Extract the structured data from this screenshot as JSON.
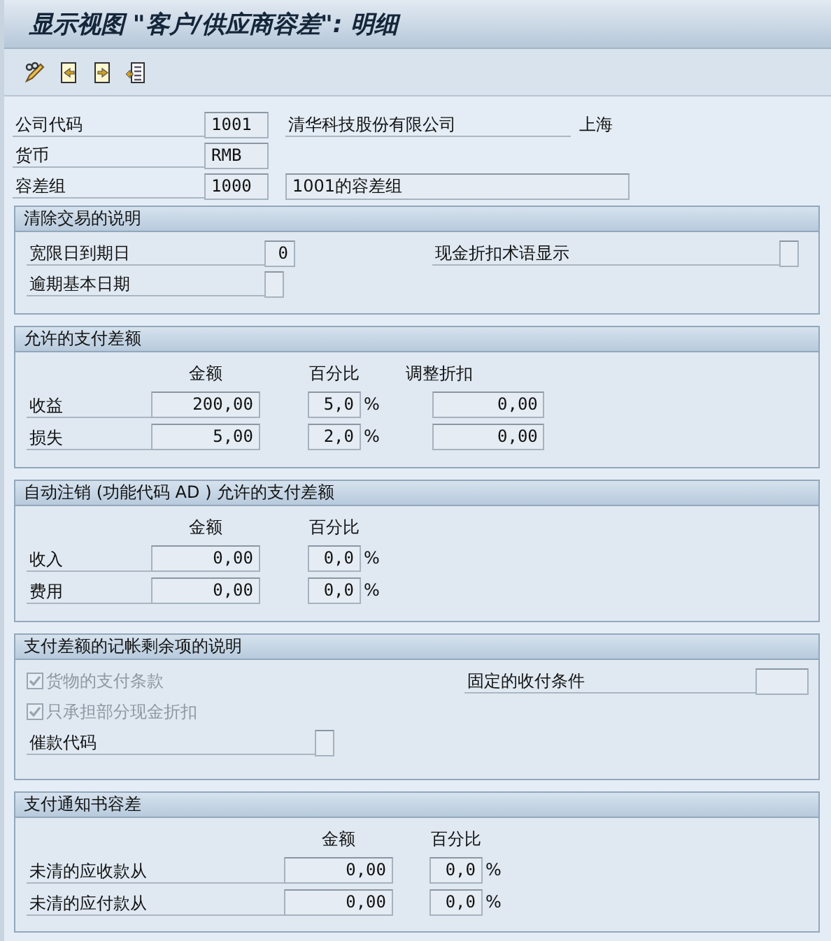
{
  "window": {
    "title": "显示视图 \"客户/供应商容差\": 明细"
  },
  "header": {
    "company_code": {
      "label": "公司代码",
      "value": "1001",
      "name": "清华科技股份有限公司",
      "city": "上海"
    },
    "currency": {
      "label": "货币",
      "value": "RMB"
    },
    "tolerance_group": {
      "label": "容差组",
      "value": "1000",
      "description": "1001的容差组"
    }
  },
  "clearing": {
    "title": "清除交易的说明",
    "grace_days": {
      "label": "宽限日到期日",
      "value": "0"
    },
    "cash_discount_display": {
      "label": "现金折扣术语显示"
    },
    "overdue_baseline": {
      "label": "逾期基本日期"
    }
  },
  "payment_differences": {
    "title": "允许的支付差额",
    "columns": [
      "金额",
      "百分比",
      "调整折扣"
    ],
    "rows": [
      {
        "label": "收益",
        "amount": "200,00",
        "percent": "5,0",
        "unit": "%",
        "adjust_discount": "0,00"
      },
      {
        "label": "损失",
        "amount": "5,00",
        "percent": "2,0",
        "unit": "%",
        "adjust_discount": "0,00"
      }
    ]
  },
  "write_off": {
    "title": "自动注销 (功能代码 AD ) 允许的支付差额",
    "columns": [
      "金额",
      "百分比"
    ],
    "rows": [
      {
        "label": "收入",
        "amount": "0,00",
        "percent": "0,0",
        "unit": "%"
      },
      {
        "label": "费用",
        "amount": "0,00",
        "percent": "0,0",
        "unit": "%"
      }
    ]
  },
  "residual": {
    "title": "支付差额的记帐剩余项的说明",
    "checkboxes": [
      {
        "label": "货物的支付条款",
        "checked": true,
        "disabled": true
      },
      {
        "label": "只承担部分现金折扣",
        "checked": true,
        "disabled": true
      }
    ],
    "fixed_terms": {
      "label": "固定的收付条件"
    },
    "dunning_key": {
      "label": "催款代码"
    }
  },
  "advice": {
    "title": "支付通知书容差",
    "columns": [
      "金额",
      "百分比"
    ],
    "rows": [
      {
        "label": "未清的应收款从",
        "amount": "0,00",
        "percent": "0,0",
        "unit": "%"
      },
      {
        "label": "未清的应付款从",
        "amount": "0,00",
        "percent": "0,0",
        "unit": "%"
      }
    ]
  }
}
